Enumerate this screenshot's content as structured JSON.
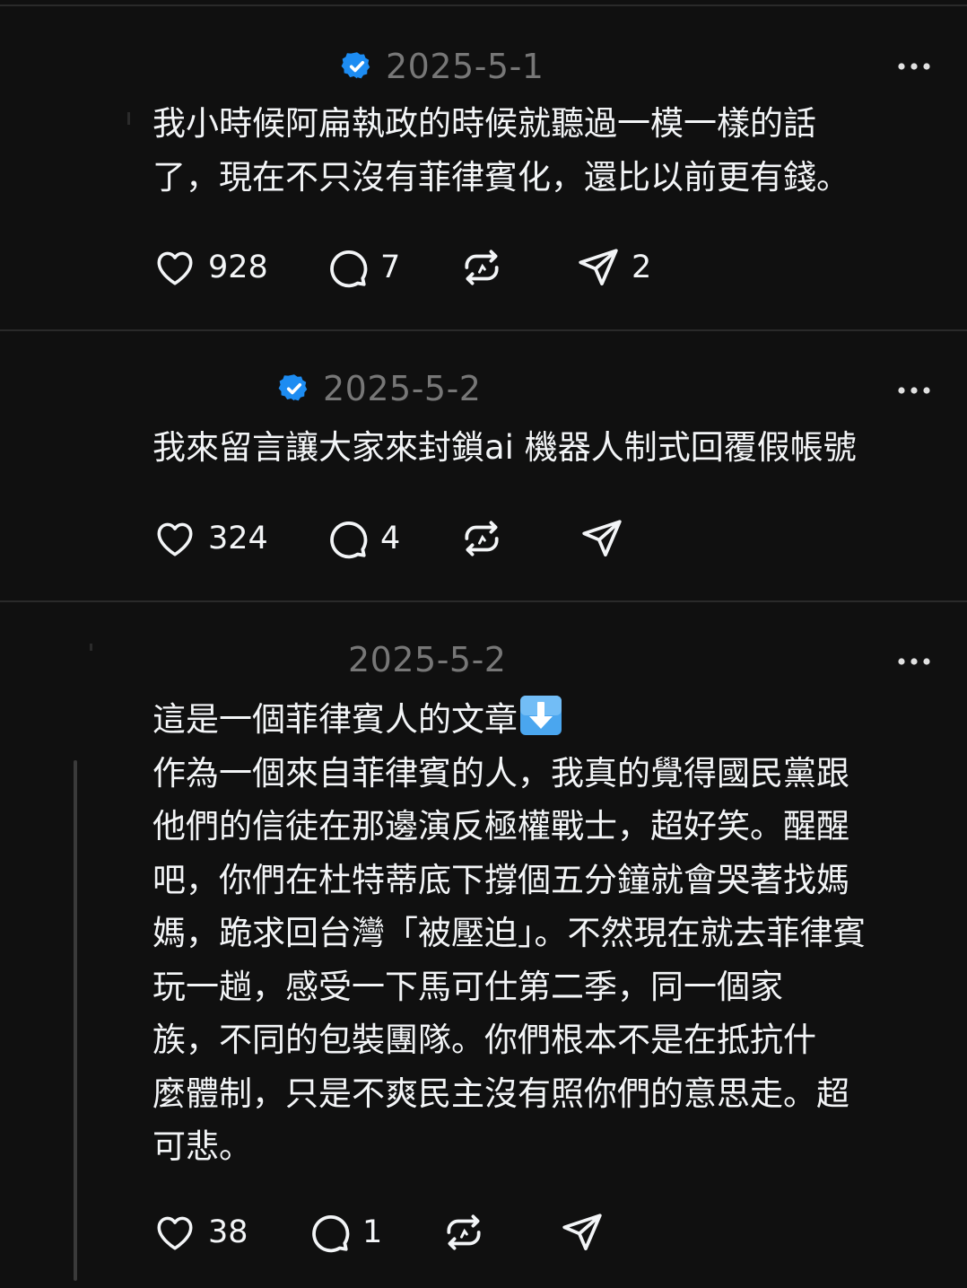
{
  "posts": [
    {
      "date": "2025-5-1",
      "verified": true,
      "text": "我小時候阿扁執政的時候就聽過一模一樣的話\n了，現在不只沒有菲律賓化，還比以前更有錢。",
      "likes": "928",
      "replies": "7",
      "shares": "2"
    },
    {
      "date": "2025-5-2",
      "verified": true,
      "text": "我來留言讓大家來封鎖ai 機器人制式回覆假帳號",
      "likes": "324",
      "replies": "4",
      "shares": ""
    },
    {
      "date": "2025-5-2",
      "verified": false,
      "text_first_line": "這是一個菲律賓人的文章",
      "text_rest": "作為一個來自菲律賓的人，我真的覺得國民黨跟\n他們的信徒在那邊演反極權戰士，超好笑。醒醒\n吧，你們在杜特蒂底下撐個五分鐘就會哭著找媽\n媽，跪求回台灣「被壓迫」。不然現在就去菲律賓\n玩一趟，感受一下馬可仕第二季，同一個家\n族，不同的包裝團隊。你們根本不是在抵抗什\n麼體制，只是不爽民主沒有照你們的意思走。超\n可悲。",
      "likes": "38",
      "replies": "1",
      "shares": ""
    }
  ],
  "icons": {
    "verified": "verified-badge-icon",
    "more": "more-options-icon",
    "like": "heart-icon",
    "reply": "comment-icon",
    "repost": "repost-icon",
    "share": "share-send-icon",
    "emoji": "down-arrow-emoji"
  },
  "colors": {
    "background": "#101010",
    "text": "#f3f5f7",
    "muted": "#777777",
    "verified_blue": "#1d8cf2",
    "divider": "#2a2a2a"
  }
}
